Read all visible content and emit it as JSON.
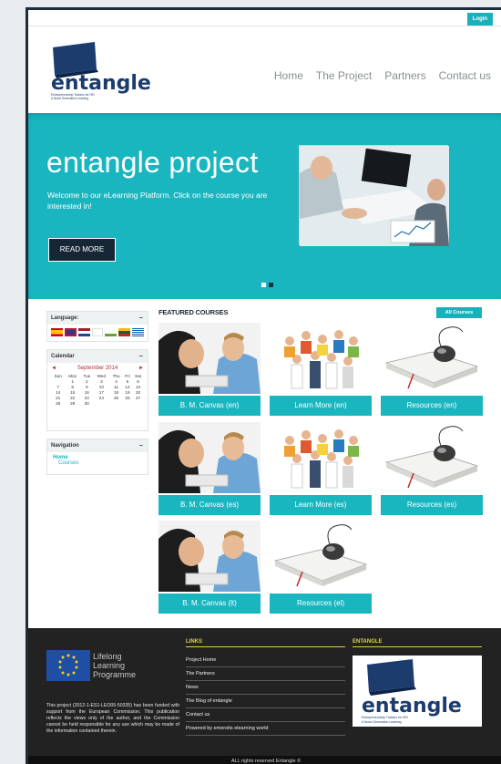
{
  "topbar": {
    "login_label": "Login"
  },
  "header": {
    "logo_text": "entangle",
    "logo_tagline_1": "Entrepreneurship Trainers for HEI",
    "logo_tagline_2": "A Novel Generation Learning",
    "nav": [
      "Home",
      "The Project",
      "Partners",
      "Contact us"
    ]
  },
  "hero": {
    "title": "entangle project",
    "subtitle": "Welcome to our eLearning Platform. Click on the course you are interested in!",
    "read_more_label": "READ MORE"
  },
  "sidebar": {
    "language_title": "Language:",
    "calendar_title": "Calendar",
    "calendar_month": "September 2014",
    "calendar_prev": "◄",
    "calendar_next": "►",
    "calendar_days": [
      "Sun",
      "Mon",
      "Tue",
      "Wed",
      "Thu",
      "Fri",
      "Sat"
    ],
    "calendar_weeks": [
      [
        "",
        "1",
        "2",
        "3",
        "4",
        "5",
        "6"
      ],
      [
        "7",
        "8",
        "9",
        "10",
        "11",
        "12",
        "13"
      ],
      [
        "14",
        "15",
        "16",
        "17",
        "18",
        "19",
        "20"
      ],
      [
        "21",
        "22",
        "23",
        "24",
        "25",
        "26",
        "27"
      ],
      [
        "28",
        "29",
        "30",
        "",
        "",
        "",
        ""
      ]
    ],
    "navigation_title": "Navigation",
    "nav_items": [
      "Home",
      "Courses"
    ],
    "toggle_symbol": "−"
  },
  "featured": {
    "title": "FEATURED COURSES",
    "all_courses_label": "All Courses",
    "courses": [
      {
        "label": "B. M. Canvas (en)",
        "thumb": "people-laptop"
      },
      {
        "label": "Learn More (en)",
        "thumb": "team-group"
      },
      {
        "label": "Resources (en)",
        "thumb": "book-mouse"
      },
      {
        "label": "B. M. Canvas (es)",
        "thumb": "people-laptop"
      },
      {
        "label": "Learn More (es)",
        "thumb": "team-group"
      },
      {
        "label": "Resources (es)",
        "thumb": "book-mouse"
      },
      {
        "label": "B. M. Canvas (lt)",
        "thumb": "people-laptop"
      },
      {
        "label": "Resources (el)",
        "thumb": "book-mouse"
      }
    ]
  },
  "footer": {
    "lll_line_1": "Lifelong",
    "lll_line_2": "Learning",
    "lll_line_3": "Programme",
    "disclaimer": "This project (2012-1-ES1-LEO05-50335) has been funded with support from the European Commission. This publication reflects the views only of the author, and the Commission cannot be held responsible for any use which may be made of the information contained therein.",
    "links_title": "LINKS",
    "links": [
      "Project Home",
      "The Partners",
      "News",
      "The Blog of entangle",
      "Contact us",
      "Powered by emeroits elearning world"
    ],
    "entangle_title": "ENTANGLE",
    "rights": "ALL rights reserved Entangle ©"
  },
  "colors": {
    "accent": "#1ab6c0",
    "dark": "#172636",
    "footer_bg": "#222222",
    "link_heading": "#d9d34b"
  }
}
